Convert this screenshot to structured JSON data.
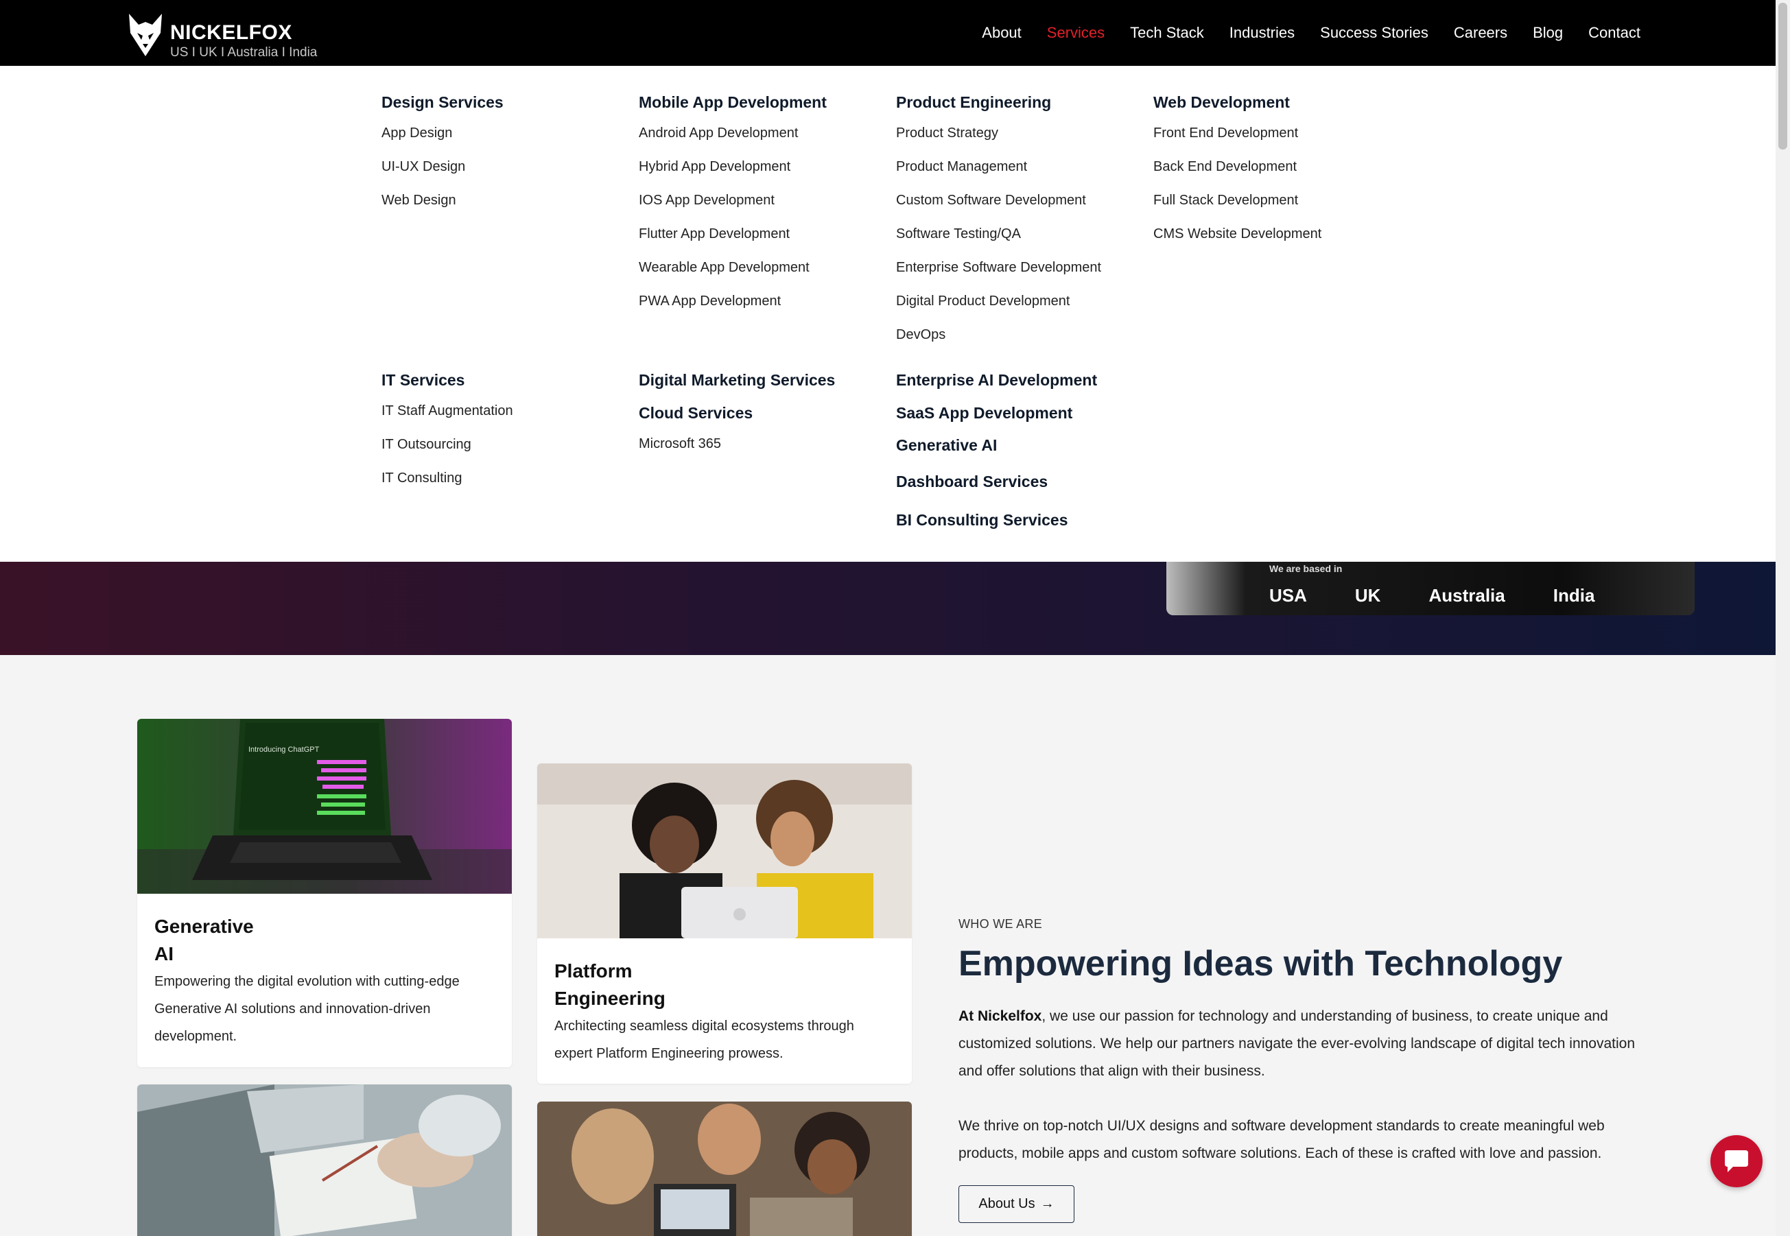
{
  "brand": {
    "name": "NICKELFOX",
    "tagline": "US I UK I Australia I India"
  },
  "nav": {
    "items": [
      "About",
      "Services",
      "Tech Stack",
      "Industries",
      "Success Stories",
      "Careers",
      "Blog",
      "Contact"
    ],
    "active": "Services"
  },
  "menu": {
    "design": {
      "title": "Design Services",
      "items": [
        "App Design",
        "UI-UX Design",
        "Web Design"
      ]
    },
    "mobile": {
      "title": "Mobile App Development",
      "items": [
        "Android App Development",
        "Hybrid App Development",
        "IOS App Development",
        "Flutter App Development",
        "Wearable App Development",
        "PWA App Development"
      ]
    },
    "product": {
      "title": "Product Engineering",
      "items": [
        "Product Strategy",
        "Product Management",
        "Custom Software Development",
        "Software Testing/QA",
        "Enterprise Software Development",
        "Digital Product Development",
        "DevOps"
      ]
    },
    "web": {
      "title": "Web Development",
      "items": [
        "Front End Development",
        "Back End Development",
        "Full Stack Development",
        "CMS Website Development"
      ]
    },
    "it": {
      "title": "IT Services",
      "items": [
        "IT Staff Augmentation",
        "IT Outsourcing",
        "IT Consulting"
      ]
    },
    "digital_marketing": {
      "title": "Digital Marketing Services"
    },
    "cloud": {
      "title": "Cloud Services",
      "items": [
        "Microsoft 365"
      ]
    },
    "standalone": [
      "Enterprise AI Development",
      "SaaS App Development",
      "Generative AI",
      "Dashboard Services",
      "BI Consulting Services"
    ]
  },
  "based_in": {
    "label": "We are based in",
    "countries": [
      "USA",
      "UK",
      "Australia",
      "India"
    ]
  },
  "cards": {
    "gen_ai": {
      "image_text": "Introducing ChatGPT",
      "title_line1": "Generative",
      "title_line2": "AI",
      "desc": "Empowering the digital evolution with cutting-edge Generative AI solutions and innovation-driven development."
    },
    "platform": {
      "title_line1": "Platform",
      "title_line2": "Engineering",
      "desc": "Architecting seamless digital ecosystems through expert Platform Engineering prowess."
    }
  },
  "who": {
    "eyebrow": "WHO WE ARE",
    "headline": "Empowering Ideas with Technology",
    "para1_bold": "At Nickelfox",
    "para1_rest": ", we use our passion for technology and understanding of business, to create unique and customized solutions. We help our partners navigate the ever-evolving landscape of digital tech innovation and offer solutions that align with their business.",
    "para2": "We thrive on top-notch UI/UX designs and software development standards to create meaningful web products, mobile apps and custom software solutions. Each of these is crafted with love and passion.",
    "button": "About Us",
    "button_arrow": "→"
  },
  "colors": {
    "accent": "#e3202b",
    "heading": "#1c2a3e",
    "nav_bg": "#000000"
  }
}
